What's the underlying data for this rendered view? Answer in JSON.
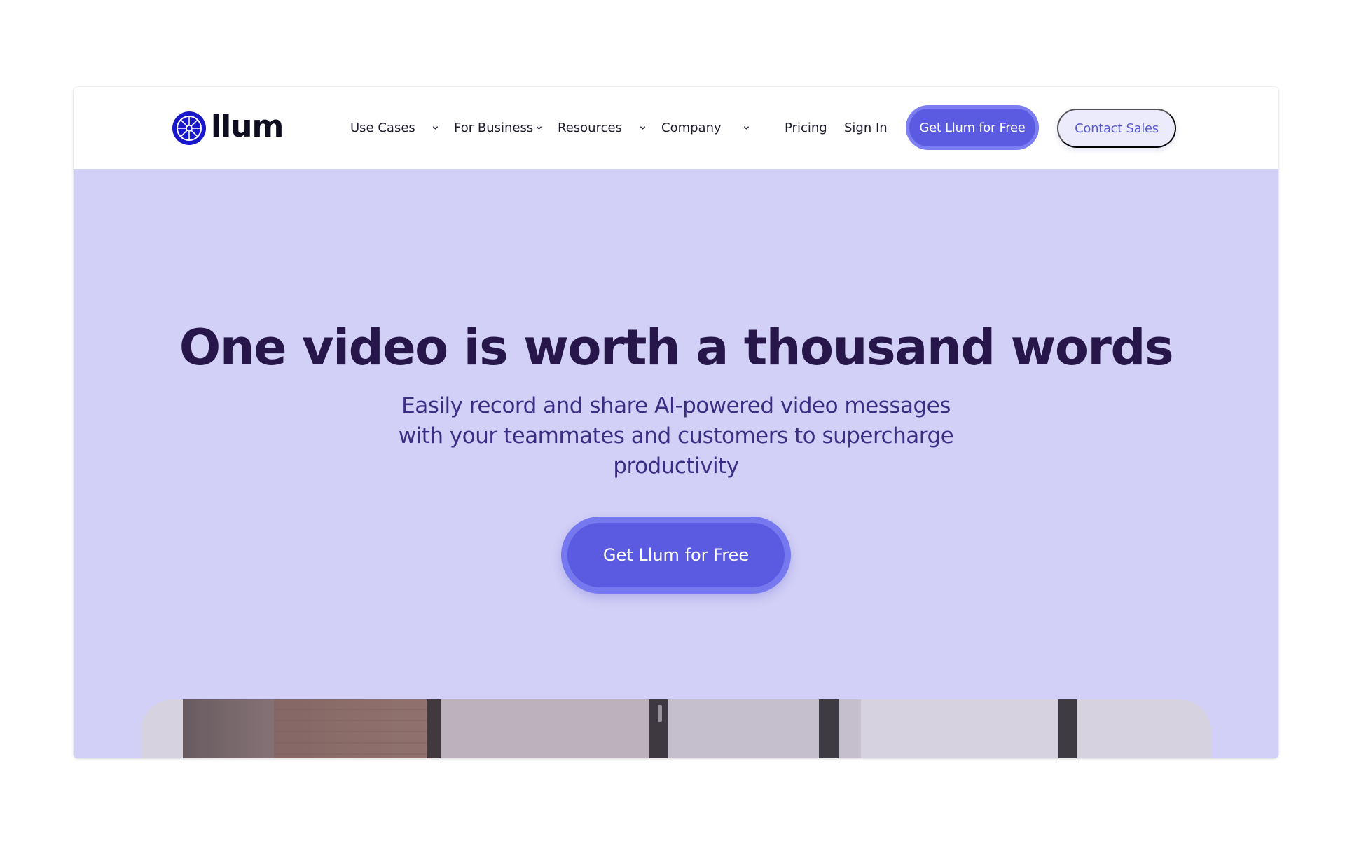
{
  "brand": {
    "name": "llum",
    "logo_icon": "aperture-icon",
    "accent_color": "#5a5be0",
    "hero_background": "#d2d0f6"
  },
  "nav": {
    "items": [
      {
        "label": "Use Cases",
        "dropdown": true
      },
      {
        "label": "For Business",
        "dropdown": true
      },
      {
        "label": "Resources",
        "dropdown": true
      },
      {
        "label": "Company",
        "dropdown": true
      },
      {
        "label": "Pricing",
        "dropdown": false
      },
      {
        "label": "Sign In",
        "dropdown": false
      }
    ],
    "primary_button": "Get Llum for Free",
    "secondary_button": "Contact Sales"
  },
  "hero": {
    "title": "One video is worth a thousand words",
    "subtitle": "Easily record and share AI-powered video messages with your teammates and customers to supercharge productivity",
    "cta": "Get Llum for Free"
  }
}
